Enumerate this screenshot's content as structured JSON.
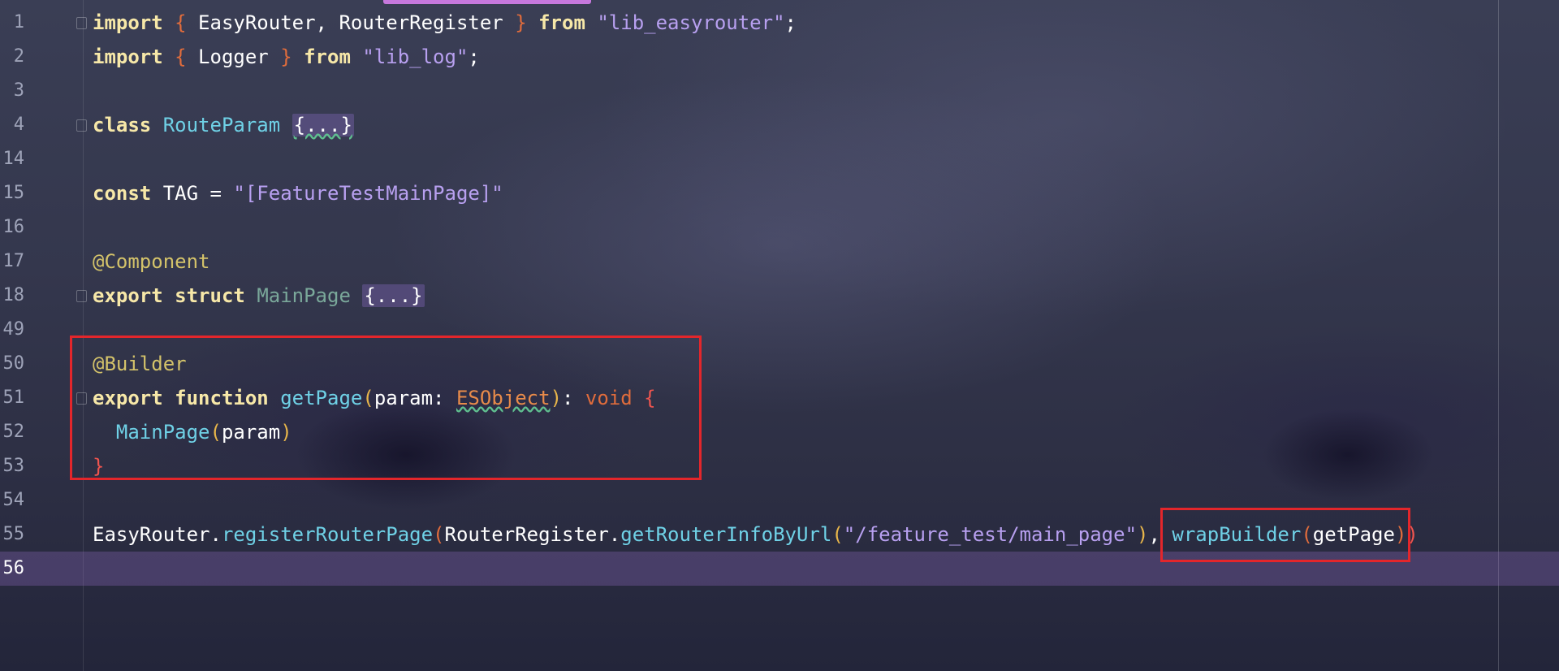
{
  "editor": {
    "accent_color": "#c678dd",
    "current_line_highlight": "#8a6ac8",
    "annotation_color": "#e3262b"
  },
  "lines": [
    {
      "number": "1",
      "tokens": [
        {
          "t": "import",
          "c": "kw"
        },
        {
          "t": " ",
          "c": "white"
        },
        {
          "t": "{",
          "c": "punc-brace"
        },
        {
          "t": " EasyRouter, RouterRegister ",
          "c": "white"
        },
        {
          "t": "}",
          "c": "punc-brace"
        },
        {
          "t": " ",
          "c": "white"
        },
        {
          "t": "from",
          "c": "kw"
        },
        {
          "t": " ",
          "c": "white"
        },
        {
          "t": "\"lib_easyrouter\"",
          "c": "str"
        },
        {
          "t": ";",
          "c": "white"
        }
      ]
    },
    {
      "number": "2",
      "tokens": [
        {
          "t": "import",
          "c": "kw"
        },
        {
          "t": " ",
          "c": "white"
        },
        {
          "t": "{",
          "c": "punc-brace"
        },
        {
          "t": " Logger ",
          "c": "white"
        },
        {
          "t": "}",
          "c": "punc-brace"
        },
        {
          "t": " ",
          "c": "white"
        },
        {
          "t": "from",
          "c": "kw"
        },
        {
          "t": " ",
          "c": "white"
        },
        {
          "t": "\"lib_log\"",
          "c": "str"
        },
        {
          "t": ";",
          "c": "white"
        }
      ]
    },
    {
      "number": "3",
      "tokens": []
    },
    {
      "number": "4",
      "tokens": [
        {
          "t": "class",
          "c": "kw"
        },
        {
          "t": " ",
          "c": "white"
        },
        {
          "t": "RouteParam",
          "c": "cls"
        },
        {
          "t": " ",
          "c": "white"
        },
        {
          "t": "{...}",
          "c": "collapsed wavy"
        }
      ]
    },
    {
      "number": "14",
      "tokens": []
    },
    {
      "number": "15",
      "tokens": [
        {
          "t": "const",
          "c": "kw"
        },
        {
          "t": " TAG = ",
          "c": "white"
        },
        {
          "t": "\"[FeatureTestMainPage]\"",
          "c": "str"
        }
      ]
    },
    {
      "number": "16",
      "tokens": []
    },
    {
      "number": "17",
      "tokens": [
        {
          "t": "@Component",
          "c": "deco"
        }
      ]
    },
    {
      "number": "18",
      "tokens": [
        {
          "t": "export",
          "c": "kw"
        },
        {
          "t": " ",
          "c": "white"
        },
        {
          "t": "struct",
          "c": "kw"
        },
        {
          "t": " ",
          "c": "white"
        },
        {
          "t": "MainPage",
          "c": "muted"
        },
        {
          "t": " ",
          "c": "white"
        },
        {
          "t": "{...}",
          "c": "collapsed"
        }
      ]
    },
    {
      "number": "49",
      "tokens": []
    },
    {
      "number": "50",
      "tokens": [
        {
          "t": "@Builder",
          "c": "deco"
        }
      ]
    },
    {
      "number": "51",
      "tokens": [
        {
          "t": "export",
          "c": "kw"
        },
        {
          "t": " ",
          "c": "white"
        },
        {
          "t": "function",
          "c": "kw"
        },
        {
          "t": " ",
          "c": "white"
        },
        {
          "t": "getPage",
          "c": "fn"
        },
        {
          "t": "(",
          "c": "paren-yellow"
        },
        {
          "t": "param: ",
          "c": "white"
        },
        {
          "t": "ESObject",
          "c": "type-warn"
        },
        {
          "t": ")",
          "c": "paren-yellow"
        },
        {
          "t": ": ",
          "c": "white"
        },
        {
          "t": "void",
          "c": "punc-brace"
        },
        {
          "t": " ",
          "c": "white"
        },
        {
          "t": "{",
          "c": "red"
        }
      ]
    },
    {
      "number": "52",
      "tokens": [
        {
          "t": "  ",
          "c": "white"
        },
        {
          "t": "MainPage",
          "c": "fn"
        },
        {
          "t": "(",
          "c": "paren-yellow"
        },
        {
          "t": "param",
          "c": "white"
        },
        {
          "t": ")",
          "c": "paren-yellow"
        }
      ]
    },
    {
      "number": "53",
      "tokens": [
        {
          "t": "}",
          "c": "red"
        }
      ]
    },
    {
      "number": "54",
      "tokens": []
    },
    {
      "number": "55",
      "tokens": [
        {
          "t": "EasyRouter.",
          "c": "white"
        },
        {
          "t": "registerRouterPage",
          "c": "fn"
        },
        {
          "t": "(",
          "c": "punc-brace"
        },
        {
          "t": "RouterRegister.",
          "c": "white"
        },
        {
          "t": "getRouterInfoByUrl",
          "c": "fn"
        },
        {
          "t": "(",
          "c": "paren-yellow"
        },
        {
          "t": "\"/feature_test/main_page\"",
          "c": "str"
        },
        {
          "t": ")",
          "c": "paren-yellow"
        },
        {
          "t": ", ",
          "c": "white"
        },
        {
          "t": "wrapBuilder",
          "c": "fn"
        },
        {
          "t": "(",
          "c": "punc-brace"
        },
        {
          "t": "getPage",
          "c": "white"
        },
        {
          "t": ")",
          "c": "punc-brace"
        },
        {
          "t": ")",
          "c": "red"
        }
      ]
    },
    {
      "number": "56",
      "tokens": [],
      "current": true
    }
  ]
}
